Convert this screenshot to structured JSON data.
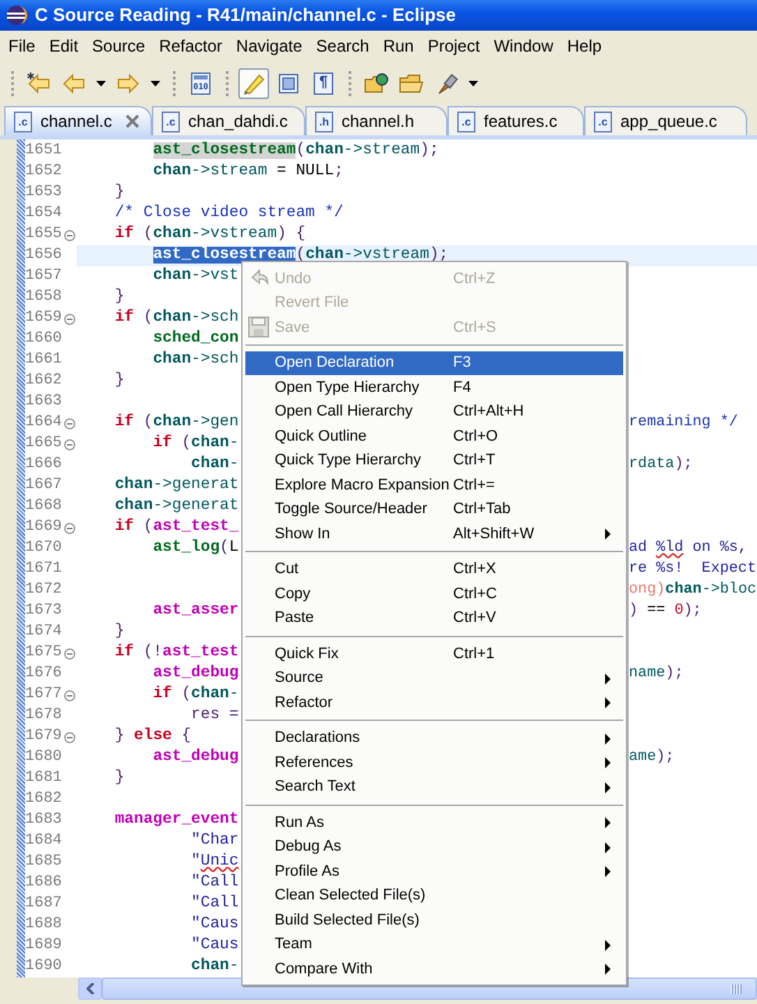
{
  "window": {
    "title": "C Source Reading - R41/main/channel.c - Eclipse"
  },
  "menu_bar": [
    "File",
    "Edit",
    "Source",
    "Refactor",
    "Navigate",
    "Search",
    "Run",
    "Project",
    "Window",
    "Help"
  ],
  "toolbar": [
    {
      "kind": "grip"
    },
    {
      "kind": "last-edit",
      "dropdown": false,
      "pressed": false
    },
    {
      "kind": "back",
      "dropdown": true,
      "pressed": false
    },
    {
      "kind": "forward",
      "dropdown": true,
      "pressed": false
    },
    {
      "kind": "grip"
    },
    {
      "kind": "binary",
      "glyph": "010",
      "dropdown": false,
      "pressed": false
    },
    {
      "kind": "grip"
    },
    {
      "kind": "highlight",
      "dropdown": false,
      "pressed": true
    },
    {
      "kind": "block",
      "dropdown": false,
      "pressed": false
    },
    {
      "kind": "pilcrow",
      "glyph": "¶",
      "dropdown": false,
      "pressed": false
    },
    {
      "kind": "grip"
    },
    {
      "kind": "open-type",
      "dropdown": false,
      "pressed": false
    },
    {
      "kind": "folder",
      "dropdown": false,
      "pressed": false
    },
    {
      "kind": "brush",
      "dropdown": true,
      "pressed": false
    }
  ],
  "tabs": [
    {
      "label": "channel.c",
      "ext": ".c",
      "selected": true,
      "closable": true
    },
    {
      "label": "chan_dahdi.c",
      "ext": ".c",
      "selected": false,
      "closable": false
    },
    {
      "label": "channel.h",
      "ext": ".h",
      "selected": false,
      "closable": false
    },
    {
      "label": "features.c",
      "ext": ".c",
      "selected": false,
      "closable": false
    },
    {
      "label": "app_queue.c",
      "ext": ".c",
      "selected": false,
      "closable": false
    }
  ],
  "code": {
    "lines": [
      {
        "number": "1651",
        "fold": false,
        "current": false,
        "tokens": [
          {
            "kind": "fn",
            "text": "        ast_closestream",
            "occurrence": true
          },
          {
            "kind": "pun",
            "text": "("
          },
          {
            "kind": "var",
            "text": "chan"
          },
          {
            "kind": "mem",
            "text": "->stream"
          },
          {
            "kind": "pun",
            "text": ");"
          }
        ]
      },
      {
        "number": "1652",
        "fold": false,
        "current": false,
        "tokens": [
          {
            "kind": "var",
            "text": "        chan"
          },
          {
            "kind": "mem",
            "text": "->stream"
          },
          {
            "kind": "pl",
            "text": " = NULL"
          },
          {
            "kind": "pun",
            "text": ";"
          }
        ]
      },
      {
        "number": "1653",
        "fold": false,
        "current": false,
        "tokens": [
          {
            "kind": "pun",
            "text": "    }"
          }
        ]
      },
      {
        "number": "1654",
        "fold": false,
        "current": false,
        "tokens": [
          {
            "kind": "com",
            "text": "    /* Close video stream */"
          }
        ]
      },
      {
        "number": "1655",
        "fold": true,
        "current": false,
        "tokens": [
          {
            "kind": "kw",
            "text": "    if"
          },
          {
            "kind": "pun",
            "text": " ("
          },
          {
            "kind": "var",
            "text": "chan"
          },
          {
            "kind": "mem",
            "text": "->vstream"
          },
          {
            "kind": "pun",
            "text": ") {"
          }
        ]
      },
      {
        "number": "1656",
        "fold": false,
        "current": true,
        "tokens": [
          {
            "kind": "fn",
            "text": "        ast_closestream",
            "selected": true
          },
          {
            "kind": "pun",
            "text": "("
          },
          {
            "kind": "var",
            "text": "chan"
          },
          {
            "kind": "mem",
            "text": "->vstream"
          },
          {
            "kind": "pun",
            "text": ");"
          }
        ]
      },
      {
        "number": "1657",
        "fold": false,
        "current": false,
        "tokens": [
          {
            "kind": "var",
            "text": "        chan"
          },
          {
            "kind": "mem",
            "text": "->vst"
          }
        ]
      },
      {
        "number": "1658",
        "fold": false,
        "current": false,
        "tokens": [
          {
            "kind": "pun",
            "text": "    }"
          }
        ]
      },
      {
        "number": "1659",
        "fold": true,
        "current": false,
        "tokens": [
          {
            "kind": "kw",
            "text": "    if"
          },
          {
            "kind": "pun",
            "text": " ("
          },
          {
            "kind": "var",
            "text": "chan"
          },
          {
            "kind": "mem",
            "text": "->sch"
          }
        ]
      },
      {
        "number": "1660",
        "fold": false,
        "current": false,
        "tokens": [
          {
            "kind": "fn",
            "text": "        sched_con"
          }
        ]
      },
      {
        "number": "1661",
        "fold": false,
        "current": false,
        "tokens": [
          {
            "kind": "var",
            "text": "        chan"
          },
          {
            "kind": "mem",
            "text": "->sch"
          }
        ]
      },
      {
        "number": "1662",
        "fold": false,
        "current": false,
        "tokens": [
          {
            "kind": "pun",
            "text": "    }"
          }
        ]
      },
      {
        "number": "1663",
        "fold": false,
        "current": false
      },
      {
        "number": "1664",
        "fold": true,
        "current": false,
        "tokens": [
          {
            "kind": "kw",
            "text": "    if"
          },
          {
            "kind": "pun",
            "text": " ("
          },
          {
            "kind": "var",
            "text": "chan"
          },
          {
            "kind": "mem",
            "text": "->gen"
          }
        ],
        "right": [
          {
            "kind": "com",
            "text": "remaining */"
          }
        ]
      },
      {
        "number": "1665",
        "fold": true,
        "current": false,
        "tokens": [
          {
            "kind": "kw",
            "text": "        if"
          },
          {
            "kind": "pun",
            "text": " ("
          },
          {
            "kind": "var",
            "text": "chan"
          },
          {
            "kind": "mem",
            "text": "-"
          }
        ]
      },
      {
        "number": "1666",
        "fold": false,
        "current": false,
        "tokens": [
          {
            "kind": "var",
            "text": "            chan"
          },
          {
            "kind": "mem",
            "text": "-"
          }
        ],
        "right": [
          {
            "kind": "mem",
            "text": "rdata"
          },
          {
            "kind": "pun",
            "text": ");"
          }
        ]
      },
      {
        "number": "1667",
        "fold": false,
        "current": false,
        "tokens": [
          {
            "kind": "var",
            "text": "    chan"
          },
          {
            "kind": "mem",
            "text": "->generat"
          }
        ]
      },
      {
        "number": "1668",
        "fold": false,
        "current": false,
        "tokens": [
          {
            "kind": "var",
            "text": "    chan"
          },
          {
            "kind": "mem",
            "text": "->generat"
          }
        ]
      },
      {
        "number": "1669",
        "fold": true,
        "current": false,
        "tokens": [
          {
            "kind": "kw",
            "text": "    if"
          },
          {
            "kind": "pun",
            "text": " ("
          },
          {
            "kind": "mac",
            "text": "ast_test_"
          }
        ]
      },
      {
        "number": "1670",
        "fold": false,
        "current": false,
        "tokens": [
          {
            "kind": "fn",
            "text": "        ast_log"
          },
          {
            "kind": "pun",
            "text": "("
          },
          {
            "kind": "pl",
            "text": "L"
          }
        ],
        "right": [
          {
            "kind": "str",
            "text": "ad "
          },
          {
            "kind": "str",
            "text": "%ld",
            "misspelled": true
          },
          {
            "kind": "str",
            "text": " on %s,"
          }
        ]
      },
      {
        "number": "1671",
        "fold": false,
        "current": false,
        "right": [
          {
            "kind": "str",
            "text": "re %s!  Expect"
          }
        ]
      },
      {
        "number": "1672",
        "fold": false,
        "current": false,
        "right": [
          {
            "kind": "cast",
            "text": "ong)"
          },
          {
            "kind": "var",
            "text": "chan"
          },
          {
            "kind": "mem",
            "text": "->bloc"
          }
        ]
      },
      {
        "number": "1673",
        "fold": false,
        "current": false,
        "tokens": [
          {
            "kind": "mac",
            "text": "        ast_asser"
          }
        ],
        "right": [
          {
            "kind": "pun",
            "text": ")"
          },
          {
            "kind": "pl",
            "text": " == "
          },
          {
            "kind": "num",
            "text": "0"
          },
          {
            "kind": "pun",
            "text": ");"
          }
        ]
      },
      {
        "number": "1674",
        "fold": false,
        "current": false,
        "tokens": [
          {
            "kind": "pun",
            "text": "    }"
          }
        ]
      },
      {
        "number": "1675",
        "fold": true,
        "current": false,
        "tokens": [
          {
            "kind": "kw",
            "text": "    if"
          },
          {
            "kind": "pun",
            "text": " (!"
          },
          {
            "kind": "mac",
            "text": "ast_test"
          }
        ]
      },
      {
        "number": "1676",
        "fold": false,
        "current": false,
        "tokens": [
          {
            "kind": "mac",
            "text": "        ast_debug"
          }
        ],
        "right": [
          {
            "kind": "mem",
            "text": "name"
          },
          {
            "kind": "pun",
            "text": ");"
          }
        ]
      },
      {
        "number": "1677",
        "fold": true,
        "current": false,
        "tokens": [
          {
            "kind": "kw",
            "text": "        if"
          },
          {
            "kind": "pun",
            "text": " ("
          },
          {
            "kind": "var",
            "text": "chan"
          },
          {
            "kind": "mem",
            "text": "-"
          }
        ]
      },
      {
        "number": "1678",
        "fold": false,
        "current": false,
        "tokens": [
          {
            "kind": "pun",
            "text": "            res ="
          }
        ]
      },
      {
        "number": "1679",
        "fold": true,
        "current": false,
        "tokens": [
          {
            "kind": "pun",
            "text": "    }"
          },
          {
            "kind": "kw",
            "text": " else"
          },
          {
            "kind": "pun",
            "text": " {"
          }
        ]
      },
      {
        "number": "1680",
        "fold": false,
        "current": false,
        "tokens": [
          {
            "kind": "mac",
            "text": "        ast_debug"
          }
        ],
        "right": [
          {
            "kind": "mem",
            "text": "ame"
          },
          {
            "kind": "pun",
            "text": ");"
          }
        ]
      },
      {
        "number": "1681",
        "fold": false,
        "current": false,
        "tokens": [
          {
            "kind": "pun",
            "text": "    }"
          }
        ]
      },
      {
        "number": "1682",
        "fold": false,
        "current": false
      },
      {
        "number": "1683",
        "fold": false,
        "current": false,
        "tokens": [
          {
            "kind": "mac",
            "text": "    manager_event"
          }
        ]
      },
      {
        "number": "1684",
        "fold": false,
        "current": false,
        "tokens": [
          {
            "kind": "str",
            "text": "            \"Char"
          }
        ]
      },
      {
        "number": "1685",
        "fold": false,
        "current": false,
        "tokens": [
          {
            "kind": "str",
            "text": "            \""
          },
          {
            "kind": "str",
            "text": "Unic",
            "misspelled": true
          }
        ]
      },
      {
        "number": "1686",
        "fold": false,
        "current": false,
        "tokens": [
          {
            "kind": "str",
            "text": "            \"Call"
          }
        ]
      },
      {
        "number": "1687",
        "fold": false,
        "current": false,
        "tokens": [
          {
            "kind": "str",
            "text": "            \"Call"
          }
        ]
      },
      {
        "number": "1688",
        "fold": false,
        "current": false,
        "tokens": [
          {
            "kind": "str",
            "text": "            \"Caus"
          }
        ]
      },
      {
        "number": "1689",
        "fold": false,
        "current": false,
        "tokens": [
          {
            "kind": "str",
            "text": "            \"Caus"
          }
        ]
      },
      {
        "number": "1690",
        "fold": false,
        "current": false,
        "tokens": [
          {
            "kind": "var",
            "text": "            chan"
          },
          {
            "kind": "mem",
            "text": "-"
          }
        ]
      }
    ]
  },
  "context_menu": {
    "items": [
      {
        "kind": "undo",
        "label": "Undo",
        "shortcut": "Ctrl+Z",
        "enabled": false,
        "selected": false,
        "submenu": false
      },
      {
        "kind": "item",
        "label": "Revert File",
        "enabled": false,
        "selected": false,
        "submenu": false
      },
      {
        "kind": "save",
        "label": "Save",
        "shortcut": "Ctrl+S",
        "enabled": false,
        "selected": false,
        "submenu": false
      },
      {
        "kind": "separator"
      },
      {
        "kind": "item",
        "label": "Open Declaration",
        "shortcut": "F3",
        "enabled": true,
        "selected": true,
        "submenu": false
      },
      {
        "kind": "item",
        "label": "Open Type Hierarchy",
        "shortcut": "F4",
        "enabled": true,
        "selected": false,
        "submenu": false
      },
      {
        "kind": "item",
        "label": "Open Call Hierarchy",
        "shortcut": "Ctrl+Alt+H",
        "enabled": true,
        "selected": false,
        "submenu": false
      },
      {
        "kind": "item",
        "label": "Quick Outline",
        "shortcut": "Ctrl+O",
        "enabled": true,
        "selected": false,
        "submenu": false
      },
      {
        "kind": "item",
        "label": "Quick Type Hierarchy",
        "shortcut": "Ctrl+T",
        "enabled": true,
        "selected": false,
        "submenu": false
      },
      {
        "kind": "item",
        "label": "Explore Macro Expansion",
        "shortcut": "Ctrl+=",
        "enabled": true,
        "selected": false,
        "submenu": false
      },
      {
        "kind": "item",
        "label": "Toggle Source/Header",
        "shortcut": "Ctrl+Tab",
        "enabled": true,
        "selected": false,
        "submenu": false
      },
      {
        "kind": "item",
        "label": "Show In",
        "shortcut": "Alt+Shift+W",
        "enabled": true,
        "selected": false,
        "submenu": true
      },
      {
        "kind": "separator"
      },
      {
        "kind": "item",
        "label": "Cut",
        "shortcut": "Ctrl+X",
        "enabled": true,
        "selected": false,
        "submenu": false
      },
      {
        "kind": "item",
        "label": "Copy",
        "shortcut": "Ctrl+C",
        "enabled": true,
        "selected": false,
        "submenu": false
      },
      {
        "kind": "item",
        "label": "Paste",
        "shortcut": "Ctrl+V",
        "enabled": true,
        "selected": false,
        "submenu": false
      },
      {
        "kind": "separator"
      },
      {
        "kind": "item",
        "label": "Quick Fix",
        "shortcut": "Ctrl+1",
        "enabled": true,
        "selected": false,
        "submenu": false
      },
      {
        "kind": "item",
        "label": "Source",
        "enabled": true,
        "selected": false,
        "submenu": true
      },
      {
        "kind": "item",
        "label": "Refactor",
        "enabled": true,
        "selected": false,
        "submenu": true
      },
      {
        "kind": "separator"
      },
      {
        "kind": "item",
        "label": "Declarations",
        "enabled": true,
        "selected": false,
        "submenu": true
      },
      {
        "kind": "item",
        "label": "References",
        "enabled": true,
        "selected": false,
        "submenu": true
      },
      {
        "kind": "item",
        "label": "Search Text",
        "enabled": true,
        "selected": false,
        "submenu": true
      },
      {
        "kind": "separator"
      },
      {
        "kind": "item",
        "label": "Run As",
        "enabled": true,
        "selected": false,
        "submenu": true
      },
      {
        "kind": "item",
        "label": "Debug As",
        "enabled": true,
        "selected": false,
        "submenu": true
      },
      {
        "kind": "item",
        "label": "Profile As",
        "enabled": true,
        "selected": false,
        "submenu": true
      },
      {
        "kind": "item",
        "label": "Clean Selected File(s)",
        "enabled": true,
        "selected": false,
        "submenu": false
      },
      {
        "kind": "item",
        "label": "Build Selected File(s)",
        "enabled": true,
        "selected": false,
        "submenu": false
      },
      {
        "kind": "item",
        "label": "Team",
        "enabled": true,
        "selected": false,
        "submenu": true
      },
      {
        "kind": "item",
        "label": "Compare With",
        "enabled": true,
        "selected": false,
        "submenu": true
      }
    ]
  }
}
